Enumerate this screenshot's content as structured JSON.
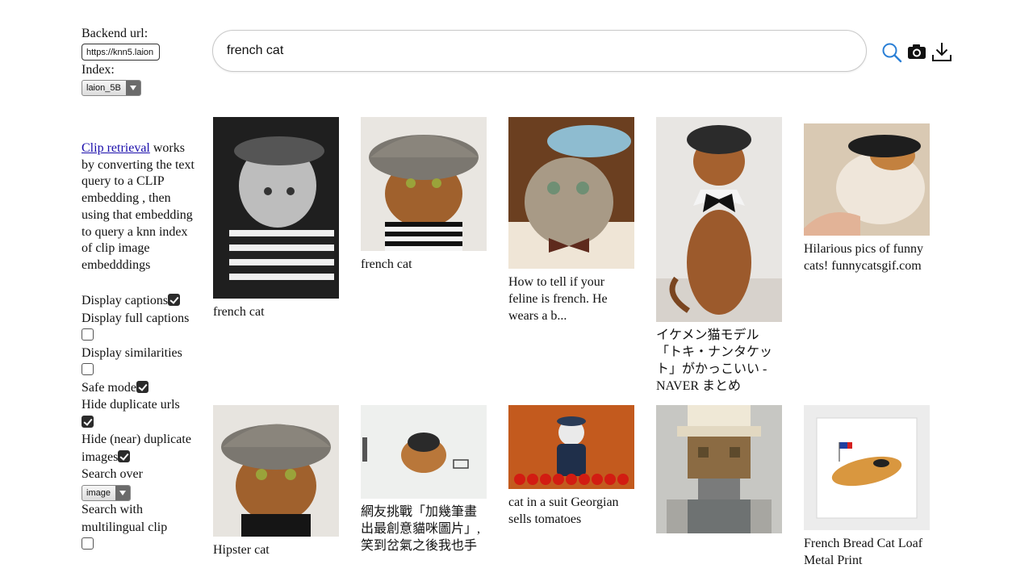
{
  "sidebar": {
    "backend_label": "Backend url:",
    "backend_value": "https://knn5.laion",
    "index_label": "Index:",
    "index_value": "laion_5B",
    "desc_link": "Clip retrieval",
    "desc_text": " works by converting the text query to a CLIP embedding , then using that embedding to query a knn index of clip image embedddings",
    "options": {
      "display_captions": "Display captions",
      "display_full_captions": "Display full captions",
      "display_similarities": "Display similarities",
      "safe_mode": "Safe mode",
      "hide_duplicate_urls": "Hide duplicate urls",
      "hide_near_duplicates": "Hide (near) duplicate images",
      "search_over": "Search over",
      "search_over_value": "image",
      "multilingual": "Search with multilingual clip"
    }
  },
  "search": {
    "query": "french cat",
    "search_icon": "search-icon",
    "camera_icon": "camera-icon",
    "download_icon": "download-icon"
  },
  "results": [
    {
      "caption": "french cat"
    },
    {
      "caption": "french cat"
    },
    {
      "caption": "How to tell if your feline is french. He wears a b..."
    },
    {
      "caption": "イケメン猫モデル「トキ・ナンタケット」がかっこいい - NAVER まとめ"
    },
    {
      "caption": "Hilarious pics of funny cats! funnycatsgif.com"
    },
    {
      "caption": "Hipster cat"
    },
    {
      "caption": "網友挑戰「加幾筆畫出最創意貓咪圖片」,笑到岔氣之後我也手"
    },
    {
      "caption": "cat in a suit Georgian sells tomatoes"
    },
    {
      "caption": ""
    },
    {
      "caption": "French Bread Cat Loaf Metal Print"
    }
  ],
  "colors": {
    "link": "#1a0dab",
    "icon_blue": "#2a7fd6"
  }
}
